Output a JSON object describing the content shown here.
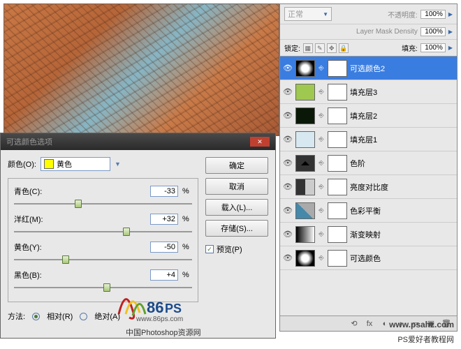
{
  "dialog": {
    "title": "可选颜色选项",
    "color_label": "颜色(O):",
    "color_value": "黄色",
    "sliders": [
      {
        "label": "青色(C):",
        "value": "-33",
        "pos": 36
      },
      {
        "label": "洋红(M):",
        "value": "+32",
        "pos": 63
      },
      {
        "label": "黄色(Y):",
        "value": "-50",
        "pos": 29
      },
      {
        "label": "黑色(B):",
        "value": "+4",
        "pos": 52
      }
    ],
    "method_label": "方法:",
    "method_rel": "相对(R)",
    "method_abs": "绝对(A)",
    "buttons": {
      "ok": "确定",
      "cancel": "取消",
      "load": "载入(L)...",
      "save": "存储(S)..."
    },
    "preview": "预览(P)"
  },
  "layers_panel": {
    "blend_mode": "正常",
    "opacity_label": "不透明度:",
    "opacity": "100%",
    "mask_density_label": "Layer Mask Density",
    "mask_density": "100%",
    "lock_label": "锁定:",
    "fill_label": "填充:",
    "fill": "100%",
    "layers": [
      {
        "name": "可选颜色2",
        "thumb_bg": "radial-gradient(circle,#fff 30%,#000 70%)",
        "selected": true
      },
      {
        "name": "填充层3",
        "thumb_bg": "#9fc850"
      },
      {
        "name": "填充层2",
        "thumb_bg": "#0a1808"
      },
      {
        "name": "填充层1",
        "thumb_bg": "#d8e8f0"
      },
      {
        "name": "色阶",
        "thumb_bg": "linear-gradient(#333,#333)",
        "thumb_content": "◢◣"
      },
      {
        "name": "亮度对比度",
        "thumb_bg": "linear-gradient(90deg,#333 50%,#ccc 50%)"
      },
      {
        "name": "色彩平衡",
        "thumb_bg": "linear-gradient(45deg,#48a 50%,#aaa 50%)"
      },
      {
        "name": "渐变映射",
        "thumb_bg": "linear-gradient(90deg,#000,#fff)"
      },
      {
        "name": "可选颜色",
        "thumb_bg": "radial-gradient(circle,#fff 30%,#000 70%)"
      }
    ]
  },
  "watermark": {
    "logo_text": "86PS",
    "cn_text": "中国Photoshop资源网",
    "url": "www.86ps.com",
    "right_text": "PS爱好者教程网",
    "right_url": "www.psahz.com"
  }
}
